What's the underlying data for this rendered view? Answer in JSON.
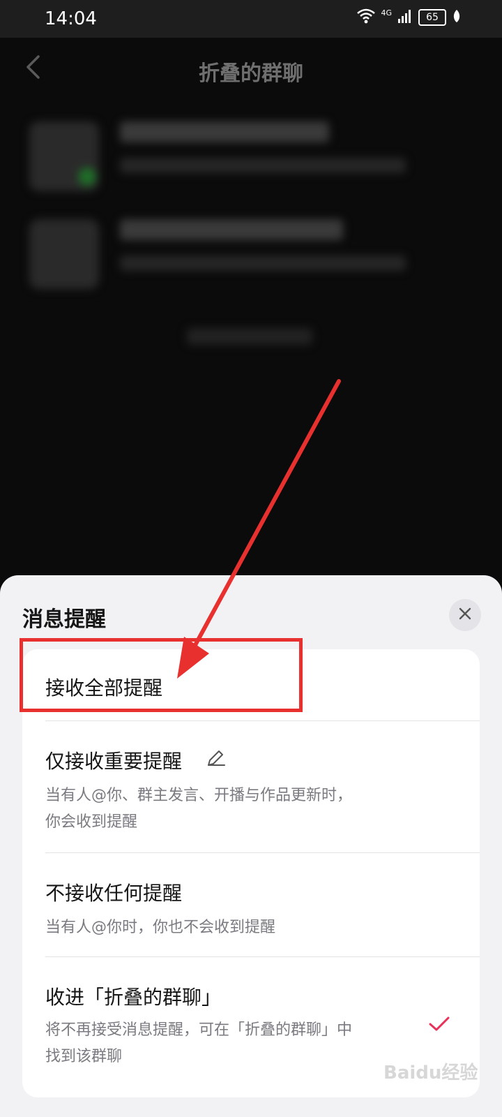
{
  "status_bar": {
    "time": "14:04",
    "network": "4G",
    "battery": "65"
  },
  "nav": {
    "title": "折叠的群聊"
  },
  "sheet": {
    "title": "消息提醒",
    "options": [
      {
        "title": "接收全部提醒",
        "desc": ""
      },
      {
        "title": "仅接收重要提醒",
        "desc_line1": "当有人@你、群主发言、开播与作品更新时，",
        "desc_line2": "你会收到提醒"
      },
      {
        "title": "不接收任何提醒",
        "desc_line1": "当有人@你时，你也不会收到提醒"
      },
      {
        "title": "收进「折叠的群聊」",
        "desc_line1": "将不再接受消息提醒，可在「折叠的群聊」中",
        "desc_line2": "找到该群聊",
        "selected": true
      }
    ]
  },
  "colors": {
    "highlight": "#e8302f",
    "check": "#e8325a",
    "sheet_bg": "#f2f2f5"
  },
  "watermark": "Baidu经验"
}
